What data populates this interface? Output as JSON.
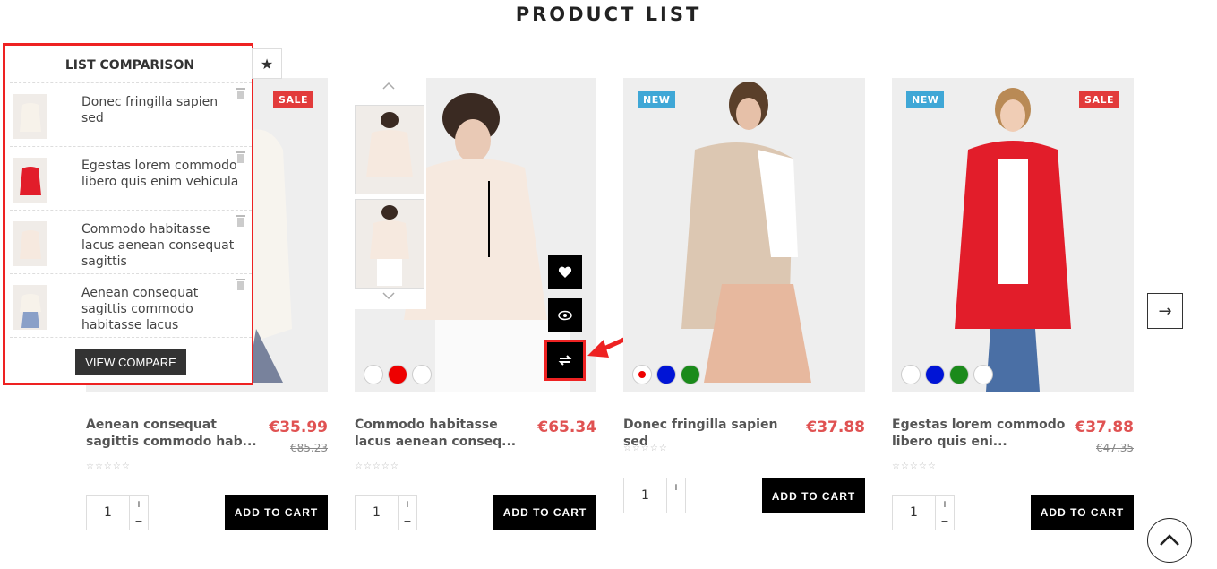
{
  "section": {
    "title": "PRODUCT LIST"
  },
  "badges": {
    "sale": "SALE",
    "new": "NEW"
  },
  "products": [
    {
      "name": "Aenean consequat sagittis commodo hab...",
      "price": "€35.99",
      "old_price": "€85.23",
      "qty": "1",
      "add_to_cart": "ADD TO CART"
    },
    {
      "name": "Commodo habitasse lacus aenean conseq...",
      "price": "€65.34",
      "qty": "1",
      "add_to_cart": "ADD TO CART"
    },
    {
      "name": "Donec fringilla sapien sed",
      "price": "€37.88",
      "qty": "1",
      "add_to_cart": "ADD TO CART"
    },
    {
      "name": "Egestas lorem commodo libero quis eni...",
      "price": "€37.88",
      "old_price": "€47.35",
      "qty": "1",
      "add_to_cart": "ADD TO CART"
    }
  ],
  "compare": {
    "title": "LIST COMPARISON",
    "items": [
      {
        "name": "Donec fringilla sapien sed"
      },
      {
        "name": "Egestas lorem commodo libero quis enim vehicula"
      },
      {
        "name": "Commodo habitasse lacus aenean consequat sagittis"
      },
      {
        "name": "Aenean consequat sagittis commodo habitasse lacus"
      }
    ],
    "button": "VIEW COMPARE"
  },
  "stepper": {
    "plus": "+",
    "minus": "−"
  },
  "icons": {
    "star_tab": "★",
    "next": "→",
    "thumb_up": "︿",
    "thumb_down": "﹀"
  },
  "colors": {
    "accent_red": "#e22222",
    "price": "#e05252",
    "sale": "#e23b3b",
    "new": "#3fa7d6"
  }
}
